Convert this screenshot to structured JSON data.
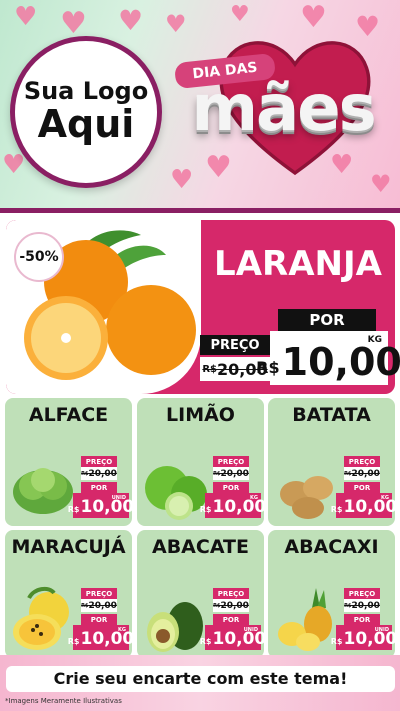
{
  "header": {
    "logo_line1": "Sua Logo",
    "logo_line2": "Aqui",
    "title_small": "DIA DAS",
    "title_big": "mães"
  },
  "featured": {
    "discount": "-50%",
    "name": "LARANJA",
    "preco_label": "PREÇO",
    "old_currency": "R$",
    "old_price": "20,00",
    "por_label": "POR",
    "new_currency": "R$",
    "new_price": "10,00",
    "unit": "KG",
    "image_icon": "orange-icon"
  },
  "products": [
    {
      "name": "ALFACE",
      "icon": "lettuce-icon",
      "preco_label": "PREÇO",
      "old_currency": "R$",
      "old_price": "20,00",
      "por_label": "POR",
      "new_currency": "R$",
      "new_price": "10,00",
      "unit": "UNID"
    },
    {
      "name": "LIMÃO",
      "icon": "lime-icon",
      "preco_label": "PREÇO",
      "old_currency": "R$",
      "old_price": "20,00",
      "por_label": "POR",
      "new_currency": "R$",
      "new_price": "10,00",
      "unit": "KG"
    },
    {
      "name": "BATATA",
      "icon": "potato-icon",
      "preco_label": "PREÇO",
      "old_currency": "R$",
      "old_price": "20,00",
      "por_label": "POR",
      "new_currency": "R$",
      "new_price": "10,00",
      "unit": "KG"
    },
    {
      "name": "MARACUJÁ",
      "icon": "passion-fruit-icon",
      "preco_label": "PREÇO",
      "old_currency": "R$",
      "old_price": "20,00",
      "por_label": "POR",
      "new_currency": "R$",
      "new_price": "10,00",
      "unit": "KG"
    },
    {
      "name": "ABACATE",
      "icon": "avocado-icon",
      "preco_label": "PREÇO",
      "old_currency": "R$",
      "old_price": "20,00",
      "por_label": "POR",
      "new_currency": "R$",
      "new_price": "10,00",
      "unit": "UNID"
    },
    {
      "name": "ABACAXI",
      "icon": "pineapple-icon",
      "preco_label": "PREÇO",
      "old_currency": "R$",
      "old_price": "20,00",
      "por_label": "POR",
      "new_currency": "R$",
      "new_price": "10,00",
      "unit": "UNID"
    }
  ],
  "footer": {
    "cta": "Crie seu encarte com este tema!",
    "disclaimer": "*Imagens Meramente Ilustrativas"
  },
  "colors": {
    "brand_pink": "#d6286a",
    "card_green": "#bfe0b8",
    "logo_ring": "#8a1f63"
  }
}
